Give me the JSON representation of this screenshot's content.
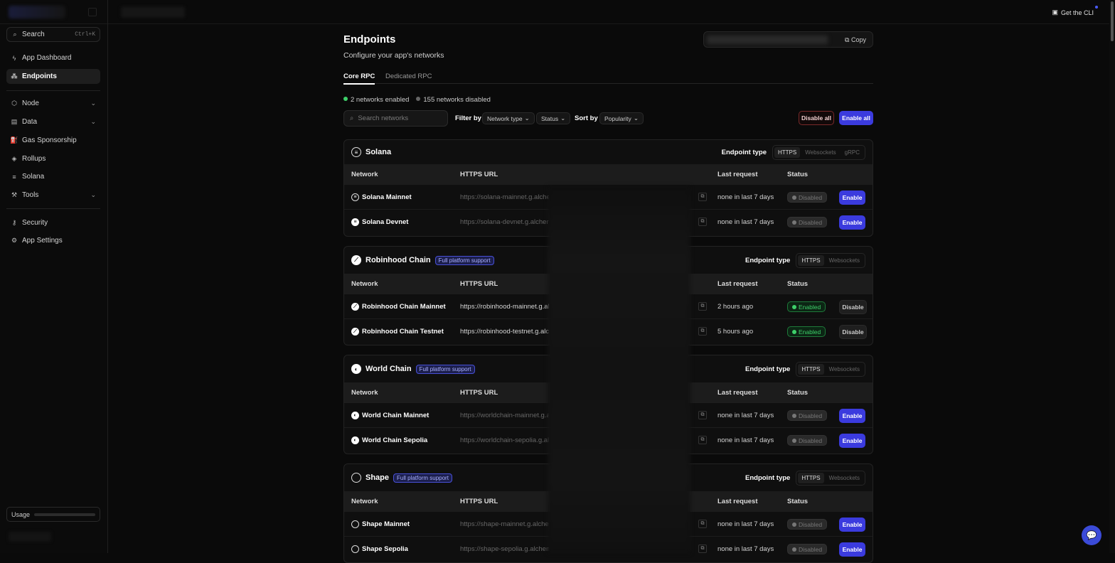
{
  "sidebar": {
    "search_label": "Search",
    "search_shortcut": "Ctrl+K",
    "items": [
      {
        "label": "App Dashboard"
      },
      {
        "label": "Endpoints"
      },
      {
        "label": "Node"
      },
      {
        "label": "Data"
      },
      {
        "label": "Gas Sponsorship"
      },
      {
        "label": "Rollups"
      },
      {
        "label": "Solana"
      },
      {
        "label": "Tools"
      },
      {
        "label": "Security"
      },
      {
        "label": "App Settings"
      }
    ],
    "usage_label": "Usage"
  },
  "topbar": {
    "cli_label": "Get the CLI"
  },
  "page": {
    "title": "Endpoints",
    "subtitle": "Configure your app's networks",
    "copy_label": "Copy",
    "tabs": [
      {
        "label": "Core RPC"
      },
      {
        "label": "Dedicated RPC"
      }
    ],
    "enabled_count": "2 networks enabled",
    "disabled_count": "155 networks disabled",
    "search_placeholder": "Search networks",
    "filter_label": "Filter by",
    "filter_network_type": "Network type",
    "filter_status": "Status",
    "sort_label": "Sort by",
    "sort_value": "Popularity",
    "disable_all": "Disable all",
    "enable_all": "Enable all"
  },
  "table_headers": {
    "network": "Network",
    "https_url": "HTTPS URL",
    "last_request": "Last request",
    "status": "Status",
    "endpoint_type": "Endpoint type"
  },
  "groups": [
    {
      "name": "Solana",
      "badge": "",
      "endpoint_types": [
        "HTTPS",
        "Websockets",
        "gRPC"
      ],
      "rows": [
        {
          "name": "Solana Mainnet",
          "url": "https://solana-mainnet.g.alche",
          "last": "none in last 7 days",
          "status": "Disabled",
          "action": "Enable"
        },
        {
          "name": "Solana Devnet",
          "url": "https://solana-devnet.g.alchem",
          "last": "none in last 7 days",
          "status": "Disabled",
          "action": "Enable"
        }
      ]
    },
    {
      "name": "Robinhood Chain",
      "badge": "Full platform support",
      "endpoint_types": [
        "HTTPS",
        "Websockets"
      ],
      "rows": [
        {
          "name": "Robinhood Chain Mainnet",
          "url": "https://robinhood-mainnet.g.al",
          "last": "2 hours ago",
          "status": "Enabled",
          "action": "Disable"
        },
        {
          "name": "Robinhood Chain Testnet",
          "url": "https://robinhood-testnet.g.alc",
          "last": "5 hours ago",
          "status": "Enabled",
          "action": "Disable"
        }
      ]
    },
    {
      "name": "World Chain",
      "badge": "Full platform support",
      "endpoint_types": [
        "HTTPS",
        "Websockets"
      ],
      "rows": [
        {
          "name": "World Chain Mainnet",
          "url": "https://worldchain-mainnet.g.a",
          "last": "none in last 7 days",
          "status": "Disabled",
          "action": "Enable"
        },
        {
          "name": "World Chain Sepolia",
          "url": "https://worldchain-sepolia.g.al",
          "last": "none in last 7 days",
          "status": "Disabled",
          "action": "Enable"
        }
      ]
    },
    {
      "name": "Shape",
      "badge": "Full platform support",
      "endpoint_types": [
        "HTTPS",
        "Websockets"
      ],
      "rows": [
        {
          "name": "Shape Mainnet",
          "url": "https://shape-mainnet.g.alche",
          "last": "none in last 7 days",
          "status": "Disabled",
          "action": "Enable"
        },
        {
          "name": "Shape Sepolia",
          "url": "https://shape-sepolia.g.alchem",
          "last": "none in last 7 days",
          "status": "Disabled",
          "action": "Enable"
        }
      ]
    }
  ],
  "colors": {
    "accent": "#3b3bde",
    "enabled": "#3ed06a",
    "disable_border": "#7a2a2a"
  }
}
